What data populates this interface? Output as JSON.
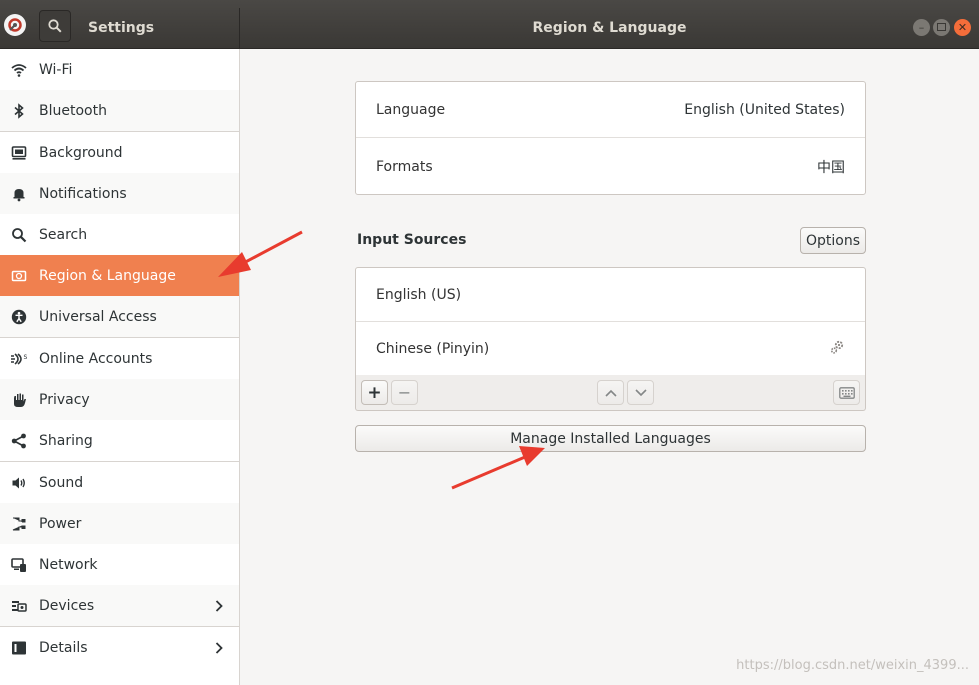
{
  "header": {
    "sidebar_title": "Settings",
    "panel_title": "Region & Language",
    "window_buttons": [
      "minimize",
      "maximize",
      "close"
    ]
  },
  "sidebar": {
    "items": [
      {
        "label": "Wi-Fi",
        "icon": "wifi-icon"
      },
      {
        "label": "Bluetooth",
        "icon": "bluetooth-icon"
      },
      {
        "label": "Background",
        "icon": "background-icon"
      },
      {
        "label": "Notifications",
        "icon": "bell-icon"
      },
      {
        "label": "Search",
        "icon": "search-icon"
      },
      {
        "label": "Region & Language",
        "icon": "region-icon",
        "active": true
      },
      {
        "label": "Universal Access",
        "icon": "accessibility-icon"
      },
      {
        "label": "Online Accounts",
        "icon": "online-accounts-icon"
      },
      {
        "label": "Privacy",
        "icon": "hand-icon"
      },
      {
        "label": "Sharing",
        "icon": "share-icon"
      },
      {
        "label": "Sound",
        "icon": "speaker-icon"
      },
      {
        "label": "Power",
        "icon": "power-plug-icon"
      },
      {
        "label": "Network",
        "icon": "network-icon"
      },
      {
        "label": "Devices",
        "icon": "devices-icon",
        "has_submenu": true
      },
      {
        "label": "Details",
        "icon": "details-icon",
        "has_submenu": true
      }
    ]
  },
  "region": {
    "language_label": "Language",
    "language_value": "English (United States)",
    "formats_label": "Formats",
    "formats_value": "中国"
  },
  "input_sources": {
    "heading": "Input Sources",
    "options_label": "Options",
    "sources": [
      {
        "label": "English (US)",
        "has_settings": false
      },
      {
        "label": "Chinese (Pinyin)",
        "has_settings": true
      }
    ],
    "toolbar": {
      "add_label": "+",
      "remove_label": "−"
    }
  },
  "manage_languages_label": "Manage Installed Languages",
  "watermark": "https://blog.csdn.net/weixin_4399...",
  "colors": {
    "accent": "#f0804f",
    "headerbar": "#3a3835",
    "annotation_arrow": "#e83b2e"
  }
}
